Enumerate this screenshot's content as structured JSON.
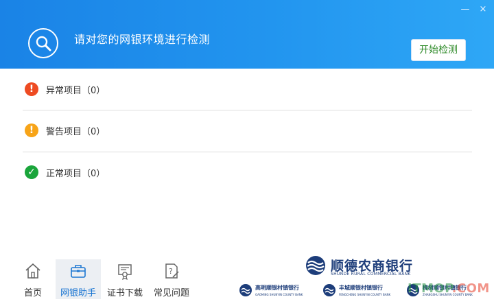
{
  "window": {
    "minimize_label": "—",
    "close_label": "×"
  },
  "header": {
    "title": "请对您的网银环境进行检测",
    "start_button": "开始检测"
  },
  "results": [
    {
      "label": "异常项目（0）",
      "status": "error",
      "color": "#ee4b22",
      "icon_glyph": "!"
    },
    {
      "label": "警告项目（0）",
      "status": "warning",
      "color": "#f7a418",
      "icon_glyph": "!"
    },
    {
      "label": "正常项目（0）",
      "status": "ok",
      "color": "#1aa53b",
      "icon_glyph": "✓"
    }
  ],
  "nav": [
    {
      "label": "首页",
      "icon": "home-icon",
      "active": false
    },
    {
      "label": "网银助手",
      "icon": "briefcase-icon",
      "active": true
    },
    {
      "label": "证书下载",
      "icon": "certificate-icon",
      "active": false
    },
    {
      "label": "常见问题",
      "icon": "faq-icon",
      "active": false
    }
  ],
  "brand": {
    "name": "顺德农商银行",
    "name_en": "SHUNDE RURAL COMMERCIAL BANK",
    "sub_banks": [
      {
        "name": "高明顺银村镇银行",
        "en": "GAOMING SHUNYIN COUNTY BANK"
      },
      {
        "name": "丰城顺银村镇银行",
        "en": "FENGCHENG SHUNYIN COUNTY BANK"
      },
      {
        "name": "樟树顺银村镇银行",
        "en": "ZHANGSHU SHUNYIN COUNTY BANK"
      }
    ]
  },
  "watermark": {
    "main": "ITMOP",
    "suffix": ".COM"
  },
  "colors": {
    "header": "#1a83e6",
    "accent_green": "#2f8b2a",
    "active_nav": "#1b76d2"
  }
}
